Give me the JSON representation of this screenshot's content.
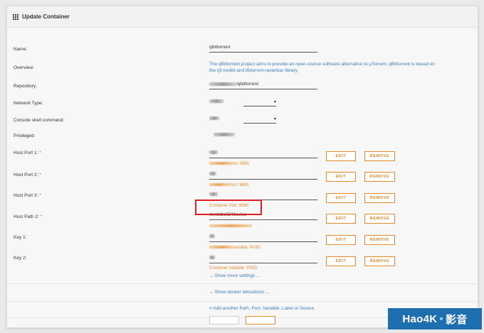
{
  "header": {
    "title": "Update Container"
  },
  "fields": {
    "name": {
      "label": "Name:",
      "value": "qbittorrent"
    },
    "overview": {
      "label": "Overview:",
      "text": "The qBittorrent project aims to provide an open-source software alternative to µTorrent. qBittorrent is based on the Qt toolkit and libtorrent-rasterbar library."
    },
    "repository": {
      "label": "Repository:",
      "value_suffix": "/qbittorrent"
    },
    "network_type": {
      "label": "Network Type:"
    },
    "console": {
      "label": "Console shell command:"
    },
    "privileged": {
      "label": "Privileged:"
    },
    "host_port_1": {
      "label": "Host Port 1:",
      "hint_suffix": "rt: 6881"
    },
    "host_port_2": {
      "label": "Host Port 2:",
      "hint_suffix": "Port: 6881"
    },
    "host_port_3": {
      "label": "Host Port 3:",
      "hint": "Container Port: 8080"
    },
    "host_path_2": {
      "label": "Host Path 2:",
      "value": "/mnt/disk5/Movies"
    },
    "key_1": {
      "label": "Key 1:",
      "hint_suffix": "ariable: PUID"
    },
    "key_2": {
      "label": "Key 2:",
      "hint_suffix": "Container Variable: PGID"
    }
  },
  "required_marker": "*",
  "buttons": {
    "edit": "EDIT",
    "remove": "REMOVE"
  },
  "links": {
    "more_settings": "Show more settings ...",
    "docker_allocations": "Show docker allocations ...",
    "add_another": "Add another Path, Port, Variable, Label or Device"
  },
  "watermark": {
    "brand": "Hao4K",
    "cn": "影音"
  },
  "colors": {
    "accent_orange": "#e8892b",
    "link_blue": "#3a7fc4",
    "highlight_red": "#e02020"
  },
  "icons": {
    "header": "grid-icon",
    "chevron": "chevron-down-icon",
    "plus": "plus-icon",
    "dropdown": "caret-down-icon"
  }
}
